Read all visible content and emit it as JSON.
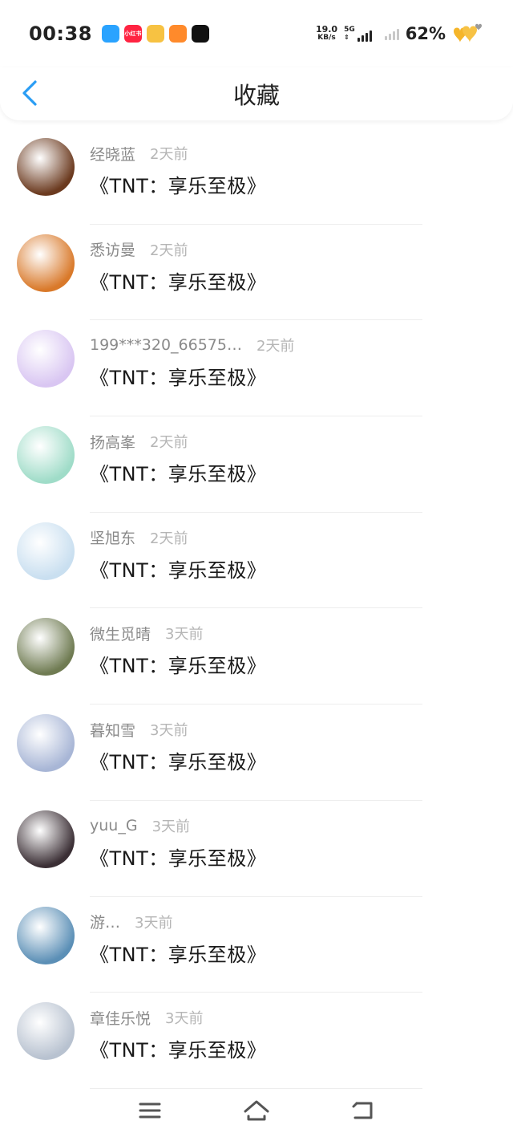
{
  "status_bar": {
    "time": "00:38",
    "app_icons": [
      {
        "name": "app-icon-1",
        "color": "#2aa3ff",
        "text": ""
      },
      {
        "name": "xiaohongshu-icon",
        "color": "#ff2442",
        "text": "小红书"
      },
      {
        "name": "weibo-icon",
        "color": "#f7c242",
        "text": ""
      },
      {
        "name": "video-app-icon",
        "color": "#ff8a2b",
        "text": ""
      },
      {
        "name": "tiktok-icon",
        "color": "#111111",
        "text": ""
      }
    ],
    "net_speed_value": "19.0",
    "net_speed_unit": "KB/s",
    "net_type": "5G",
    "battery": "62%"
  },
  "header": {
    "title": "收藏",
    "back_color": "#2a9df4"
  },
  "items": [
    {
      "user": "经晓蓝",
      "time": "2天前",
      "title": "《TNT：享乐至极》",
      "avatar_color": "#6b3a1f"
    },
    {
      "user": "悉访曼",
      "time": "2天前",
      "title": "《TNT：享乐至极》",
      "avatar_color": "#d9792a"
    },
    {
      "user": "199***320_66575…",
      "time": "2天前",
      "title": "《TNT：享乐至极》",
      "avatar_color": "#d9c6f2"
    },
    {
      "user": "扬高峯",
      "time": "2天前",
      "title": "《TNT：享乐至极》",
      "avatar_color": "#9fdcc8"
    },
    {
      "user": "坚旭东",
      "time": "2天前",
      "title": "《TNT：享乐至极》",
      "avatar_color": "#c9dff0"
    },
    {
      "user": "微生觅晴",
      "time": "3天前",
      "title": "《TNT：享乐至极》",
      "avatar_color": "#6f7b52"
    },
    {
      "user": "暮知雪",
      "time": "3天前",
      "title": "《TNT：享乐至极》",
      "avatar_color": "#a8b6d6"
    },
    {
      "user": "yuu_G",
      "time": "3天前",
      "title": "《TNT：享乐至极》",
      "avatar_color": "#3b2f35"
    },
    {
      "user": "游…",
      "time": "3天前",
      "title": "《TNT：享乐至极》",
      "avatar_color": "#5b8fb6"
    },
    {
      "user": "章佳乐悦",
      "time": "3天前",
      "title": "《TNT：享乐至极》",
      "avatar_color": "#b8c2d0"
    }
  ]
}
